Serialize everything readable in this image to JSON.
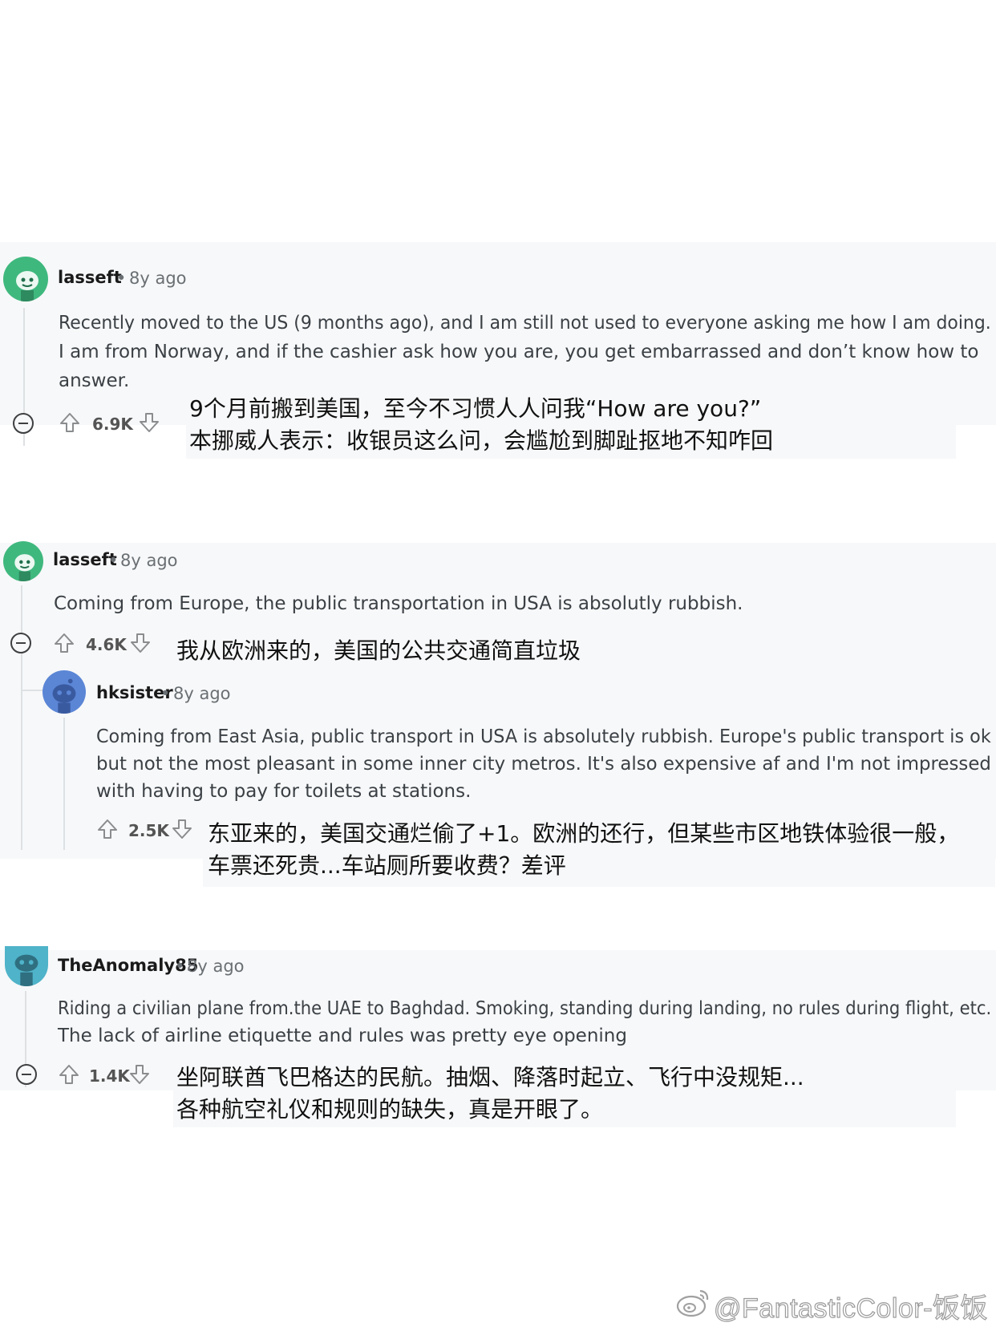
{
  "comments": [
    {
      "username": "lasseft",
      "sep": "•",
      "age": "8y ago",
      "body": [
        "Recently moved to the US (9 months ago), and I am still not used to everyone asking me how I am doing.",
        "I am from Norway, and if the cashier ask how you are, you get embarrassed and don’t know how to",
        "answer."
      ],
      "score": "6.9K",
      "caption": [
        "9个月前搬到美国，至今不习惯人人问我“How are you?”",
        "本挪威人表示：收银员这么问，会尴尬到脚趾抠地不知咋回"
      ]
    },
    {
      "username": "lasseft",
      "sep": "•",
      "age": "8y ago",
      "body": [
        "Coming from Europe, the public transportation in USA is absolutly rubbish."
      ],
      "score": "4.6K",
      "caption": [
        "我从欧洲来的，美国的公共交通简直垃圾"
      ]
    },
    {
      "username": "hksister",
      "sep": "•",
      "age": "8y ago",
      "body": [
        "Coming from East Asia, public transport in USA is absolutely rubbish. Europe's public transport is ok",
        "but not the most pleasant in some inner city metros. It's also expensive af and I'm not impressed",
        "with having to pay for toilets at stations."
      ],
      "score": "2.5K",
      "caption": [
        "东亚来的，美国交通烂偷了+1。欧洲的还行，但某些市区地铁体验很一般，",
        "车票还死贵...车站厕所要收费？差评"
      ]
    },
    {
      "username": "TheAnomaly85",
      "sep": "•",
      "age": "8y ago",
      "body": [
        "Riding a civilian plane from.the UAE to Baghdad. Smoking, standing during landing, no rules during flight, etc.",
        "The lack of airline etiquette and rules was pretty eye opening"
      ],
      "score": "1.4K",
      "caption": [
        "坐阿联酋飞巴格达的民航。抽烟、降落时起立、飞行中没规矩...",
        "各种航空礼仪和规则的缺失，真是开眼了。"
      ]
    }
  ],
  "watermark": "@FantasticColor-饭饭",
  "icons": {
    "avatar": "reddit-snoo-avatar",
    "collapse": "collapse-minus-icon",
    "upvote": "upvote-arrow-icon",
    "downvote": "downvote-arrow-icon",
    "weibo": "weibo-logo"
  },
  "colors": {
    "card_bg": "#f7f8f9",
    "avatar_green": "#3fb87e",
    "avatar_blue": "#5b86d6",
    "avatar_teal": "#4fb3c9"
  }
}
